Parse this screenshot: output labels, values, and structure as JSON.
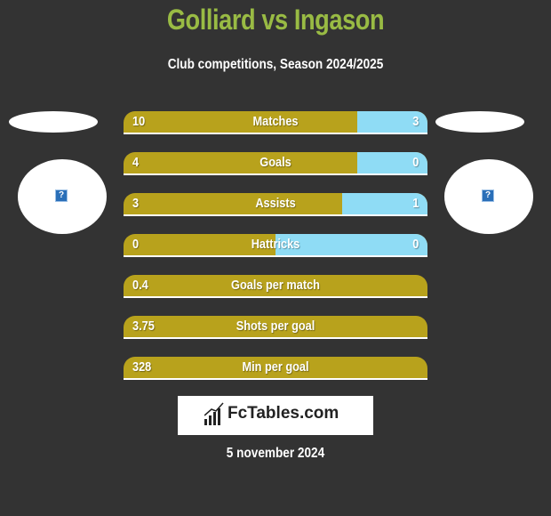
{
  "header": {
    "title": "Golliard vs Ingason",
    "subtitle": "Club competitions, Season 2024/2025"
  },
  "teams": {
    "left": {
      "name": "Golliard",
      "logo_icon": "question-mark-icon"
    },
    "right": {
      "name": "Ingason",
      "logo_icon": "question-mark-icon"
    }
  },
  "colors": {
    "title": "#99bb44",
    "left_bar": "#b8a21c",
    "right_bar": "#8fdcf5",
    "background": "#333333"
  },
  "chart_data": {
    "type": "bar",
    "orientation": "horizontal-comparison",
    "title": "Golliard vs Ingason",
    "subtitle": "Club competitions, Season 2024/2025",
    "categories": [
      "Matches",
      "Goals",
      "Assists",
      "Hattricks",
      "Goals per match",
      "Shots per goal",
      "Min per goal"
    ],
    "series": [
      {
        "name": "Golliard",
        "values": [
          10,
          4,
          3,
          0,
          0.4,
          3.75,
          328
        ],
        "labels": [
          "10",
          "4",
          "3",
          "0",
          "0.4",
          "3.75",
          "328"
        ]
      },
      {
        "name": "Ingason",
        "values": [
          3,
          0,
          1,
          0,
          null,
          null,
          null
        ],
        "labels": [
          "3",
          "0",
          "1",
          "0",
          "",
          "",
          ""
        ]
      }
    ],
    "right_share": [
      0.23,
      0.23,
      0.28,
      0.5,
      0,
      0,
      0
    ]
  },
  "footer": {
    "brand": "FcTables.com",
    "brand_icon": "bar-chart-icon",
    "date": "5 november 2024"
  }
}
